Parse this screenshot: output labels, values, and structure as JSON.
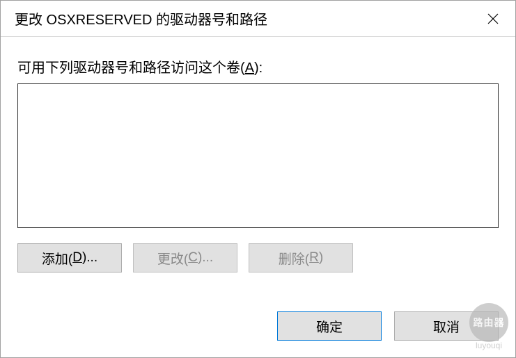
{
  "title": "更改 OSXRESERVED 的驱动器号和路径",
  "label_prefix": "可用下列驱动器号和路径访问这个卷(",
  "label_hot": "A",
  "label_suffix": "):",
  "buttons": {
    "add_prefix": "添加(",
    "add_hot": "D",
    "add_suffix": ")...",
    "change_prefix": "更改(",
    "change_hot": "C",
    "change_suffix": ")...",
    "remove_prefix": "删除(",
    "remove_hot": "R",
    "remove_suffix": ")",
    "ok": "确定",
    "cancel": "取消"
  },
  "watermark": {
    "circle": "路由器",
    "domain": "luyouqi"
  }
}
